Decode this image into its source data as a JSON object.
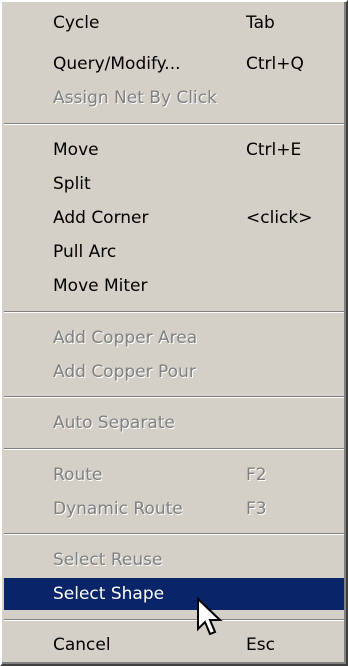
{
  "menu": {
    "items": [
      {
        "label": "Cycle",
        "shortcut": "Tab",
        "disabled": false
      },
      {
        "label": "Query/Modify...",
        "shortcut": "Ctrl+Q",
        "disabled": false
      },
      {
        "label": "Assign Net By Click",
        "shortcut": "",
        "disabled": true
      },
      {
        "label": "Move",
        "shortcut": "Ctrl+E",
        "disabled": false
      },
      {
        "label": "Split",
        "shortcut": "",
        "disabled": false
      },
      {
        "label": "Add Corner",
        "shortcut": "<click>",
        "disabled": false
      },
      {
        "label": "Pull Arc",
        "shortcut": "",
        "disabled": false
      },
      {
        "label": "Move Miter",
        "shortcut": "",
        "disabled": false
      },
      {
        "label": "Add Copper Area",
        "shortcut": "",
        "disabled": true
      },
      {
        "label": "Add Copper Pour",
        "shortcut": "",
        "disabled": true
      },
      {
        "label": "Auto Separate",
        "shortcut": "",
        "disabled": true
      },
      {
        "label": "Route",
        "shortcut": "F2",
        "disabled": true
      },
      {
        "label": "Dynamic Route",
        "shortcut": "F3",
        "disabled": true
      },
      {
        "label": "Select Reuse",
        "shortcut": "",
        "disabled": true
      },
      {
        "label": "Select Shape",
        "shortcut": "",
        "disabled": false,
        "selected": true
      },
      {
        "label": "Cancel",
        "shortcut": "Esc",
        "disabled": false
      }
    ]
  },
  "colors": {
    "menu_face": "#d4d0c8",
    "highlight": "#0a246a",
    "disabled_text": "#808080"
  },
  "cursor": {
    "icon": "arrow-pointer-icon"
  }
}
